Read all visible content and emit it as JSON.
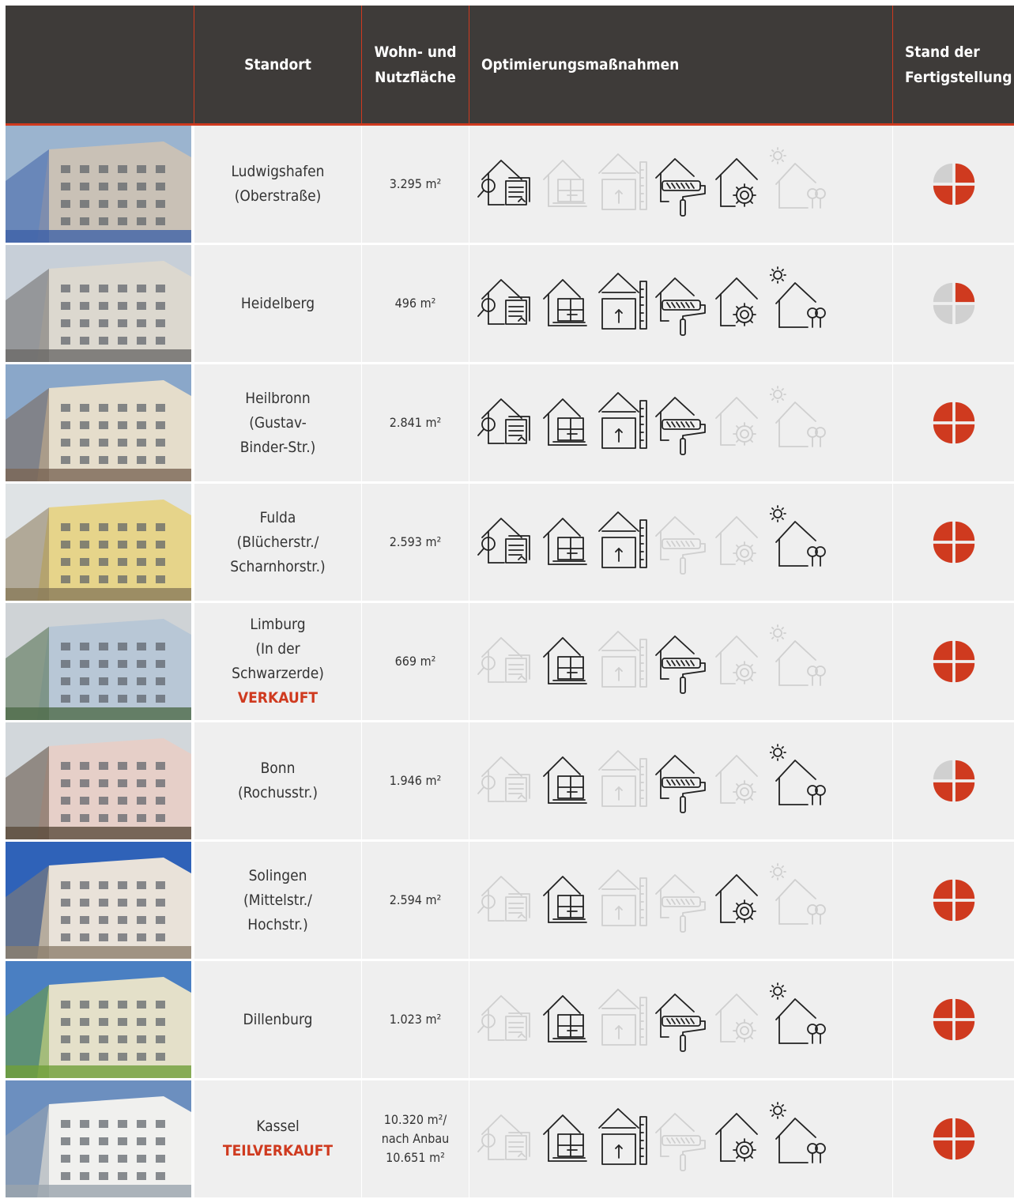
{
  "header": {
    "col_location": "Standort",
    "col_area": "Wohn- und Nutzfläche",
    "col_area_line1": "Wohn- und",
    "col_area_line2": "Nutzfläche",
    "col_measures": "Optimierungsmaßnahmen",
    "col_status_line1": "Stand der",
    "col_status_line2": "Fertigstellung"
  },
  "colors": {
    "accent": "#cf3a1f",
    "header_bg": "#3e3b39",
    "inactive": "#cfcfcf",
    "status_grey": "#d0d0d0"
  },
  "measure_icons": [
    "analysis-documents-icon",
    "floor-plan-icon",
    "extension-height-icon",
    "painting-roller-icon",
    "technology-gear-icon",
    "energy-sun-trees-icon"
  ],
  "rows": [
    {
      "location": [
        "Ludwigshafen",
        "(Oberstraße)"
      ],
      "sold": "",
      "area": [
        "3.295 m²"
      ],
      "measures": [
        true,
        false,
        false,
        true,
        true,
        false
      ],
      "status_quarters_done": 3
    },
    {
      "location": [
        "Heidelberg"
      ],
      "sold": "",
      "area": [
        "496 m²"
      ],
      "measures": [
        true,
        true,
        true,
        true,
        true,
        true
      ],
      "status_quarters_done": 1
    },
    {
      "location": [
        "Heilbronn",
        "(Gustav-",
        "Binder-Str.)"
      ],
      "sold": "",
      "area": [
        "2.841 m²"
      ],
      "measures": [
        true,
        true,
        true,
        true,
        false,
        false
      ],
      "status_quarters_done": 4
    },
    {
      "location": [
        "Fulda",
        "(Blücherstr./",
        "Scharnhorstr.)"
      ],
      "sold": "",
      "area": [
        "2.593 m²"
      ],
      "measures": [
        true,
        true,
        true,
        false,
        false,
        true
      ],
      "status_quarters_done": 4
    },
    {
      "location": [
        "Limburg",
        "(In der",
        "Schwarzerde)"
      ],
      "sold": "VERKAUFT",
      "area": [
        "669 m²"
      ],
      "measures": [
        false,
        true,
        false,
        true,
        false,
        false
      ],
      "status_quarters_done": 4
    },
    {
      "location": [
        "Bonn",
        "(Rochusstr.)"
      ],
      "sold": "",
      "area": [
        "1.946 m²"
      ],
      "measures": [
        false,
        true,
        false,
        true,
        false,
        true
      ],
      "status_quarters_done": 3
    },
    {
      "location": [
        "Solingen",
        "(Mittelstr./",
        "Hochstr.)"
      ],
      "sold": "",
      "area": [
        "2.594 m²"
      ],
      "measures": [
        false,
        true,
        false,
        false,
        true,
        false
      ],
      "status_quarters_done": 4
    },
    {
      "location": [
        "Dillenburg"
      ],
      "sold": "",
      "area": [
        "1.023 m²"
      ],
      "measures": [
        false,
        true,
        false,
        true,
        false,
        true
      ],
      "status_quarters_done": 4
    },
    {
      "location": [
        "Kassel"
      ],
      "sold": "TEILVERKAUFT",
      "area": [
        "10.320 m²/",
        "nach Anbau",
        "10.651 m²"
      ],
      "measures": [
        false,
        true,
        true,
        false,
        true,
        true
      ],
      "status_quarters_done": 4
    }
  ]
}
